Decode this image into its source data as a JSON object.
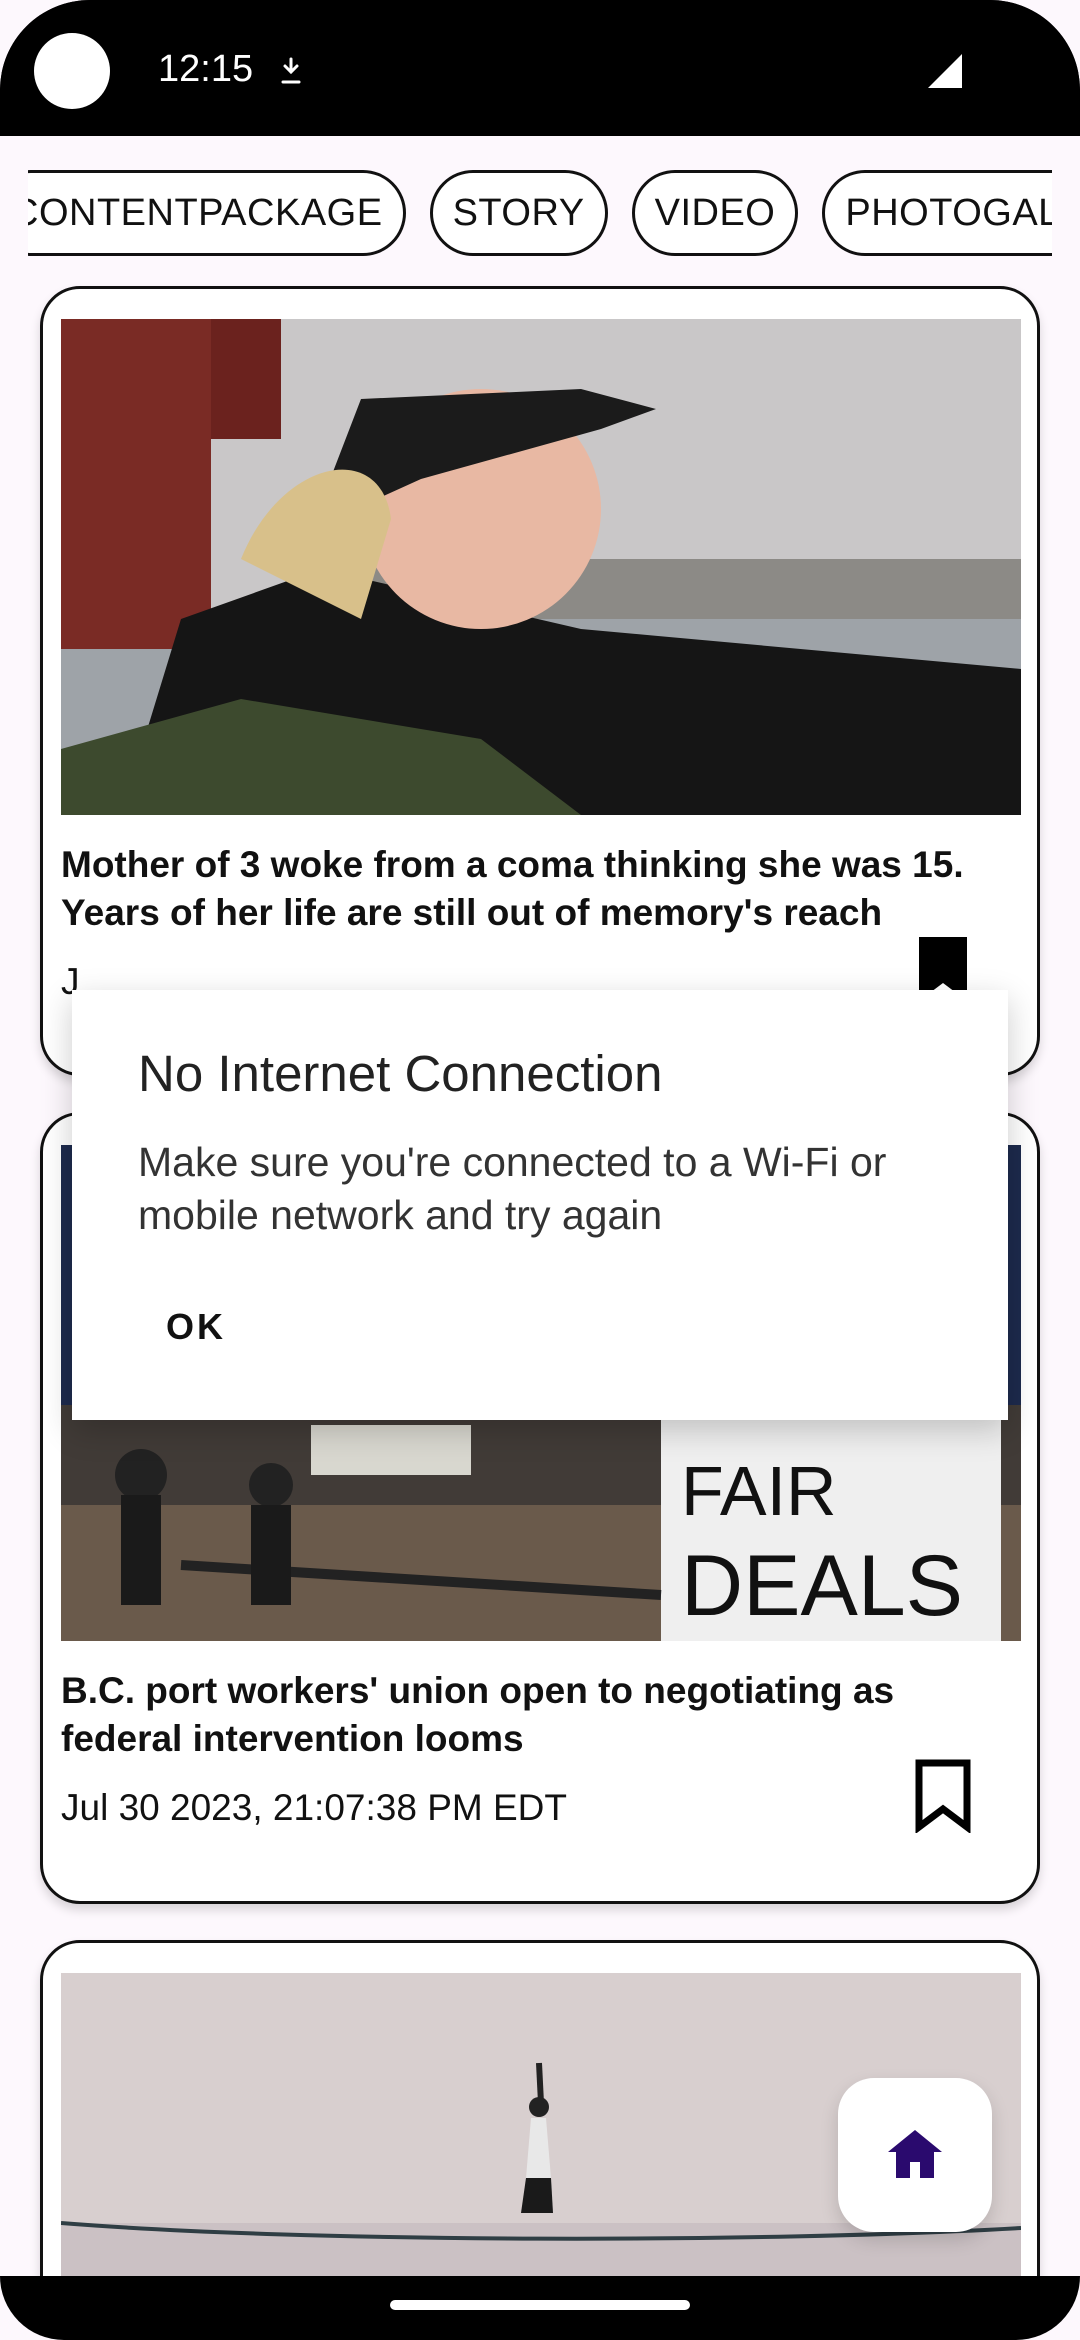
{
  "status_bar": {
    "time": "12:15"
  },
  "chips": [
    {
      "label": "CONTENTPACKAGE"
    },
    {
      "label": "STORY"
    },
    {
      "label": "VIDEO"
    },
    {
      "label": "PHOTOGALLERY"
    }
  ],
  "cards": [
    {
      "headline": "Mother of 3 woke from a coma thinking she was 15. Years of her life are still out of memory's reach",
      "date": "J"
    },
    {
      "headline": "B.C. port workers' union open to negotiating as federal intervention looms",
      "date": "Jul 30 2023, 21:07:38 PM EDT",
      "sign_text": "FAIR DEALS"
    },
    {
      "headline": "",
      "date": ""
    }
  ],
  "dialog": {
    "title": "No Internet Connection",
    "message": "Make sure you're connected to a Wi-Fi or mobile network and try again",
    "ok_label": "OK"
  },
  "fab": {
    "icon": "home-icon",
    "color": "#2a0a6e"
  }
}
